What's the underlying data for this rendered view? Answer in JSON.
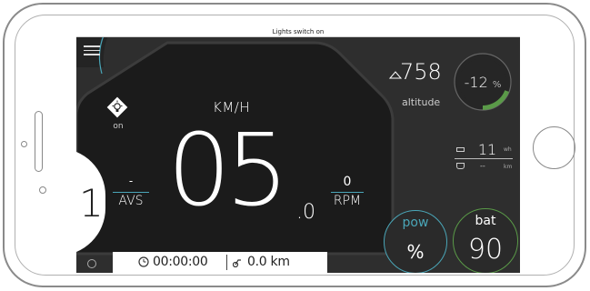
{
  "status": {
    "message": "Lights switch on"
  },
  "speed": {
    "unit": "KM/H",
    "value": "05",
    "decimal": ".0"
  },
  "gear": {
    "value": "1"
  },
  "avs": {
    "value": "-",
    "label": "AVS"
  },
  "rpm": {
    "value": "0",
    "label": "RPM"
  },
  "lights": {
    "state": "on",
    "icon": "lightbulb-icon"
  },
  "altitude": {
    "value": "758",
    "label": "altitude",
    "icon": "mountain-icon"
  },
  "slope": {
    "value": "-12",
    "unit": "%"
  },
  "energy": {
    "value": "11",
    "unit": "wh",
    "icon": "battery-small-icon"
  },
  "range": {
    "value": "--",
    "unit": "km",
    "icon": "range-icon"
  },
  "power": {
    "label": "pow",
    "value": "%"
  },
  "battery": {
    "label": "bat",
    "value": "90"
  },
  "timer": {
    "value": "00:00:00",
    "icon": "clock-icon"
  },
  "distance": {
    "value": "0.0 km",
    "icon": "bike-icon"
  },
  "colors": {
    "accent_blue": "#4aa6b8",
    "accent_green": "#5a9a48",
    "background": "#2e2e2e"
  }
}
